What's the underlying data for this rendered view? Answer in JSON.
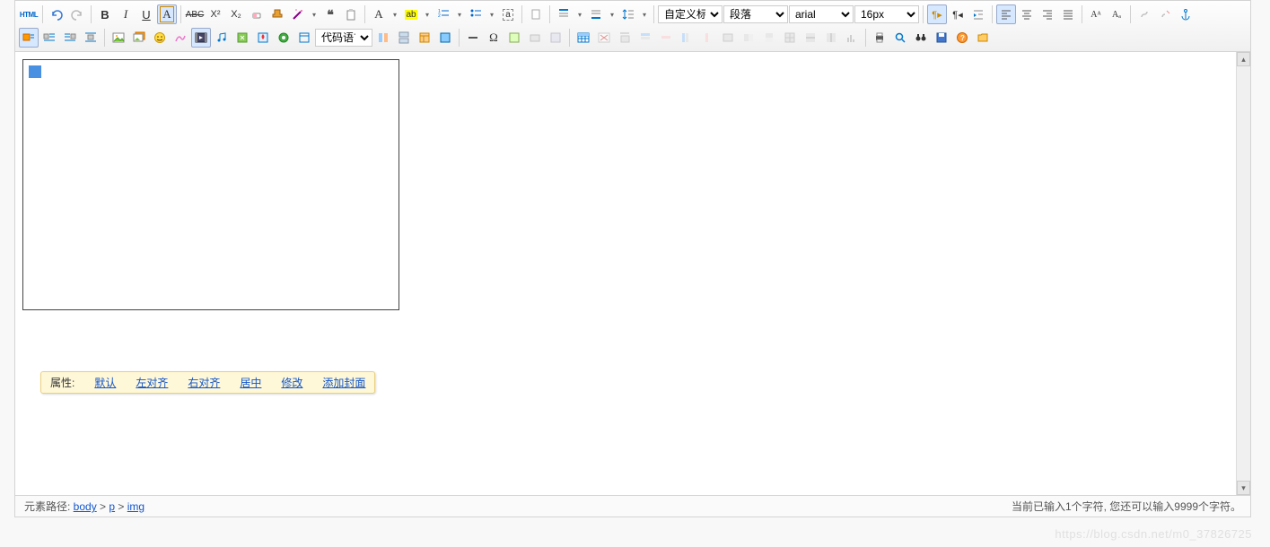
{
  "toolbar": {
    "row1": {
      "html": "HTML",
      "bold": "B",
      "italic": "I",
      "underline": "U",
      "select_title": "自定义标题",
      "select_para": "段落",
      "select_font": "arial",
      "select_size": "16px"
    },
    "row2": {
      "code_lang": "代码语言"
    }
  },
  "attrbar": {
    "label": "属性:",
    "default": "默认",
    "left": "左对齐",
    "right": "右对齐",
    "center": "居中",
    "modify": "修改",
    "addcover": "添加封面"
  },
  "status": {
    "path_label": "元素路径: ",
    "p1": "body",
    "sep": " > ",
    "p2": "p",
    "p3": "img",
    "count": "当前已输入1个字符, 您还可以输入9999个字符。"
  },
  "watermark": "https://blog.csdn.net/m0_37826725"
}
